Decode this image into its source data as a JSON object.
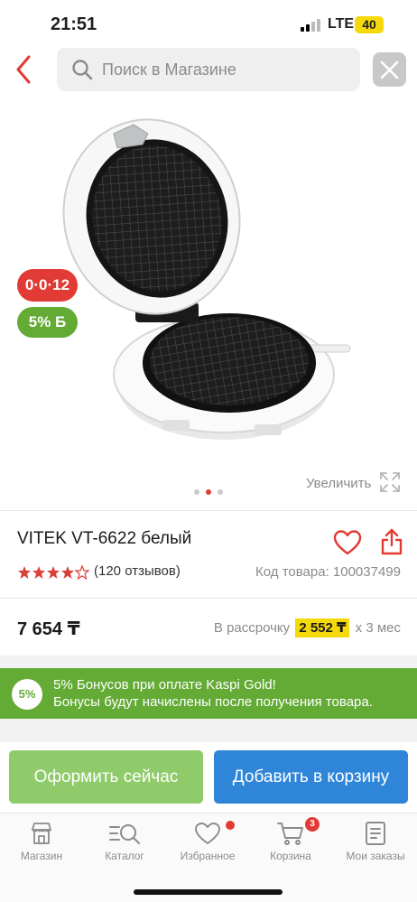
{
  "status_bar": {
    "time": "21:51",
    "network": "LTE",
    "battery": "40"
  },
  "search": {
    "placeholder": "Поиск в Магазине"
  },
  "badges": {
    "installment": "0·0·12",
    "bonus": "5% Б"
  },
  "gallery": {
    "zoom_label": "Увеличить",
    "total_images": 3,
    "active_index": 2
  },
  "product": {
    "title": "VITEK VT-6622 белый",
    "rating": 4.5,
    "reviews": "(120 отзывов)",
    "code": "Код товара: 100037499",
    "price": "7 654 ₸",
    "installment_prefix": "В рассрочку",
    "installment_amount": "2 552 ₸",
    "installment_suffix": "х 3 мес"
  },
  "bonus_banner": {
    "circle": "5%",
    "line1": "5% Бонусов при оплате Kaspi Gold!",
    "line2": "Бонусы будут начислены после получения товара."
  },
  "actions": {
    "order_now": "Оформить сейчас",
    "add_to_cart": "Добавить в корзину"
  },
  "tabbar": {
    "items": [
      {
        "label": "Магазин",
        "icon": "shop-icon"
      },
      {
        "label": "Каталог",
        "icon": "catalog-icon"
      },
      {
        "label": "Избранное",
        "icon": "heart-icon"
      },
      {
        "label": "Корзина",
        "icon": "cart-icon",
        "badge": "3"
      },
      {
        "label": "Мои заказы",
        "icon": "orders-icon"
      }
    ]
  },
  "colors": {
    "kaspi_red": "#e23a35",
    "bonus_green": "#63ab35",
    "cart_blue": "#2f86d8",
    "order_green": "#8fcb6a",
    "highlight_yellow": "#f5d90a"
  }
}
